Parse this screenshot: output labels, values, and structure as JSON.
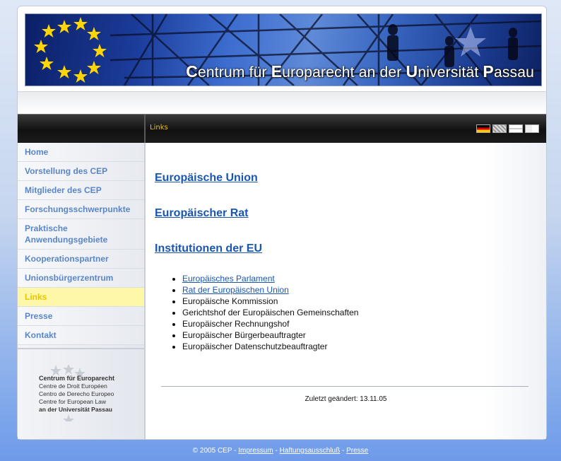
{
  "header": {
    "title_parts": [
      {
        "initial": "C",
        "rest": "entrum für "
      },
      {
        "initial": "E",
        "rest": "uroparecht an der "
      },
      {
        "initial": "U",
        "rest": "niversität "
      },
      {
        "initial": "P",
        "rest": "assau"
      }
    ]
  },
  "breadcrumb": "Links",
  "languages": [
    "de-flag-icon",
    "uk-flag-icon",
    "fr-flag-icon",
    "es-flag-icon"
  ],
  "nav": [
    {
      "label": "Home"
    },
    {
      "label": "Vorstellung des CEP"
    },
    {
      "label": "Mitglieder des CEP"
    },
    {
      "label": "Forschungsschwerpunkte"
    },
    {
      "label": "Praktische Anwendungsgebiete"
    },
    {
      "label": "Kooperationspartner"
    },
    {
      "label": "Unionsbürgerzentrum"
    },
    {
      "label": "Links",
      "active": true
    },
    {
      "label": "Presse"
    },
    {
      "label": "Kontakt"
    }
  ],
  "logo": {
    "lines": [
      "Centrum für Europarecht",
      "Centre de Droit Européen",
      "Centro de Derecho Europeo",
      "Centre for European Law",
      "an der Universität Passau"
    ]
  },
  "content": {
    "headings": [
      "Europäische Union",
      "Europäischer Rat",
      "Institutionen der EU"
    ],
    "institutions": [
      {
        "label": "Europäisches Parlament",
        "link": true
      },
      {
        "label": "Rat der Europäischen Union",
        "link": true
      },
      {
        "label": "Europäische Kommission",
        "link": false
      },
      {
        "label": "Gerichtshof der Europäischen Gemeinschaften",
        "link": false
      },
      {
        "label": "Europäischer Rechnungshof",
        "link": false
      },
      {
        "label": "Europäischer Bürgerbeauftragter",
        "link": false
      },
      {
        "label": "Europäischer Datenschutzbeauftragter",
        "link": false
      }
    ],
    "last_changed": "Zuletzt geändert: 13.11.05"
  },
  "footer": {
    "copyright": "© 2005 CEP",
    "sep": " - ",
    "links": [
      "Impressum",
      "Haftungsausschluß",
      "Presse"
    ]
  }
}
